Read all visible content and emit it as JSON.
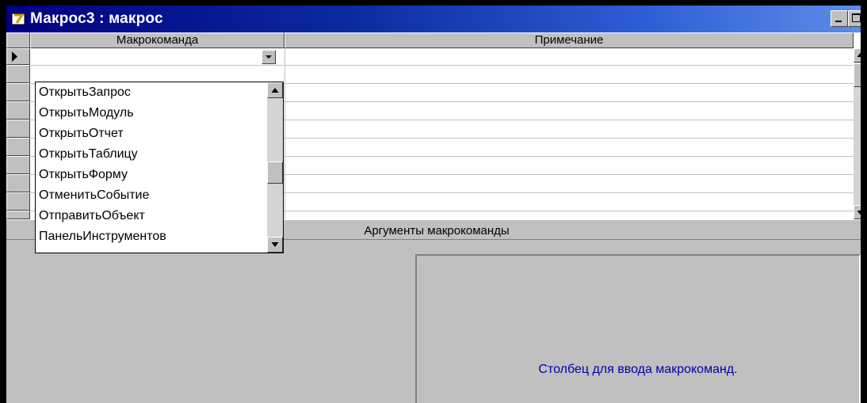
{
  "window": {
    "title": "Макрос3 : макрос",
    "title_icon": "macro-icon"
  },
  "grid": {
    "columns": [
      "Макрокоманда",
      "Примечание"
    ],
    "current_action_value": "",
    "current_note_value": ""
  },
  "dropdown": {
    "items": [
      "ОткрытьЗапрос",
      "ОткрытьМодуль",
      "ОткрытьОтчет",
      "ОткрытьТаблицу",
      "ОткрытьФорму",
      "ОтменитьСобытие",
      "ОтправитьОбъект",
      "ПанельИнструментов"
    ]
  },
  "arguments": {
    "label": "Аргументы макрокоманды",
    "help_text": "Столбец для ввода макрокоманд."
  },
  "colors": {
    "title_start": "#000080",
    "title_end": "#5d8ee8",
    "face": "#c0c0c0",
    "help_text": "#0000a8"
  }
}
